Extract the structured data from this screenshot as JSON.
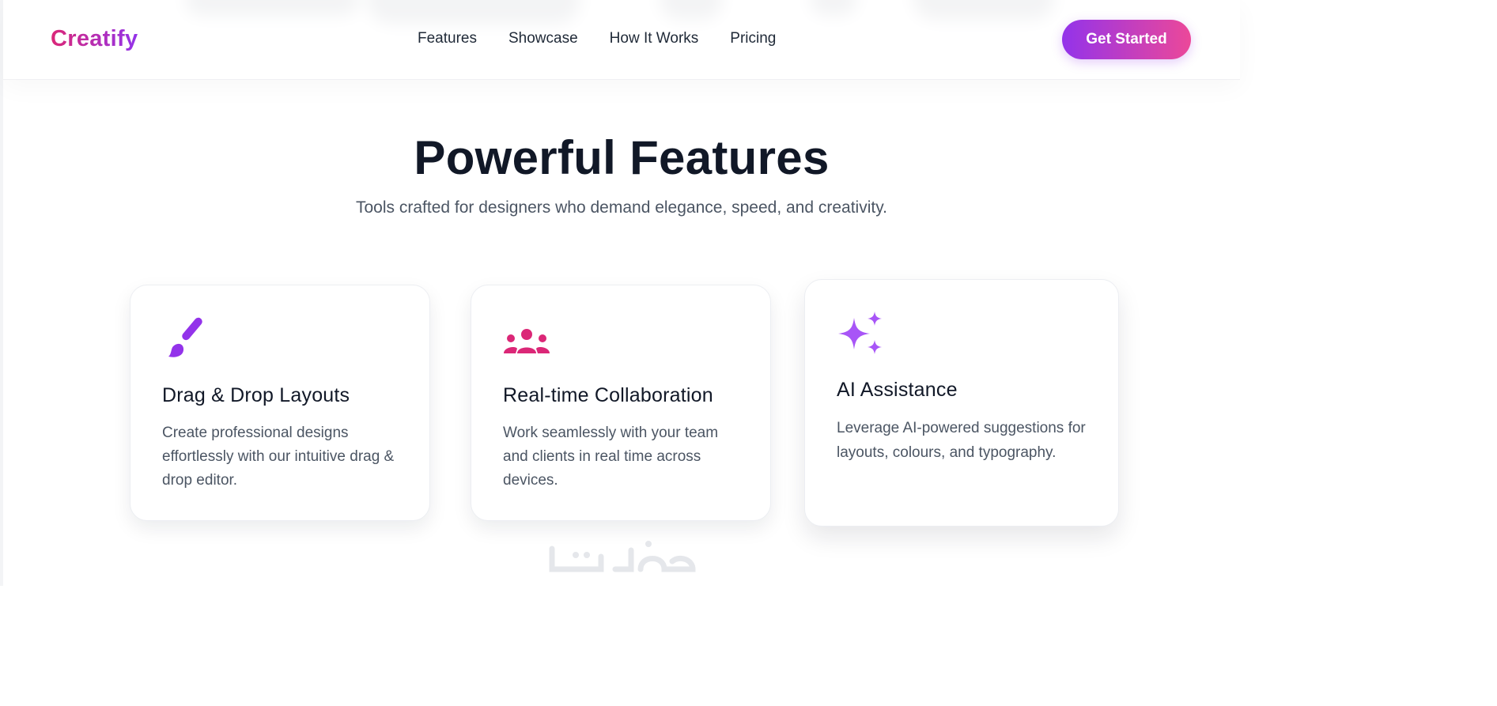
{
  "brand": {
    "name": "Creatify"
  },
  "nav": {
    "links": [
      {
        "label": "Features"
      },
      {
        "label": "Showcase"
      },
      {
        "label": "How It Works"
      },
      {
        "label": "Pricing"
      }
    ],
    "cta_label": "Get Started"
  },
  "features": {
    "title": "Powerful Features",
    "subtitle": "Tools crafted for designers who demand elegance, speed, and creativity.",
    "cards": [
      {
        "icon": "paintbrush-icon",
        "title": "Drag & Drop Layouts",
        "text": "Create professional designs effortlessly with our intuitive drag & drop editor."
      },
      {
        "icon": "users-icon",
        "title": "Real-time Collaboration",
        "text": "Work seamlessly with your team and clients in real time across devices."
      },
      {
        "icon": "sparkles-icon",
        "title": "AI Assistance",
        "text": "Leverage AI-powered suggestions for layouts, colours, and typography."
      }
    ]
  },
  "colors": {
    "brand_gradient_start": "#9333ea",
    "brand_gradient_end": "#ec4899",
    "icon_purple": "#9333ea",
    "icon_pink": "#db2777",
    "icon_violet": "#a855f7",
    "heading": "#111827",
    "body_text": "#4b5563"
  },
  "watermark": {
    "icon": "khamsat-watermark-logo"
  }
}
